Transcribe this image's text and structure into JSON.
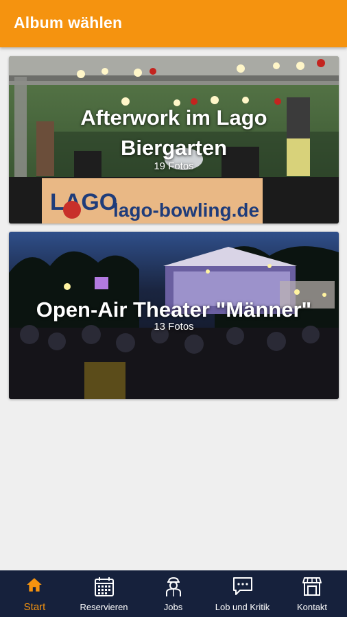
{
  "header": {
    "title": "Album wählen"
  },
  "albums": [
    {
      "title_line1": "Afterwork im Lago",
      "title_line2": "Biergarten",
      "count": "19 Fotos",
      "banner_logo": "LAGO",
      "banner_url": "lago-bowling.de"
    },
    {
      "title": "Open-Air Theater \"Männer\"",
      "count": "13 Fotos"
    }
  ],
  "nav": {
    "items": [
      {
        "label": "Start",
        "icon": "home-icon",
        "active": true
      },
      {
        "label": "Reservieren",
        "icon": "calendar-icon",
        "active": false
      },
      {
        "label": "Jobs",
        "icon": "worker-icon",
        "active": false
      },
      {
        "label": "Lob und Kritik",
        "icon": "chat-icon",
        "active": false
      },
      {
        "label": "Kontakt",
        "icon": "store-icon",
        "active": false
      }
    ]
  },
  "colors": {
    "accent": "#f5930f",
    "nav_bg": "#16213c",
    "background": "#efefef"
  }
}
